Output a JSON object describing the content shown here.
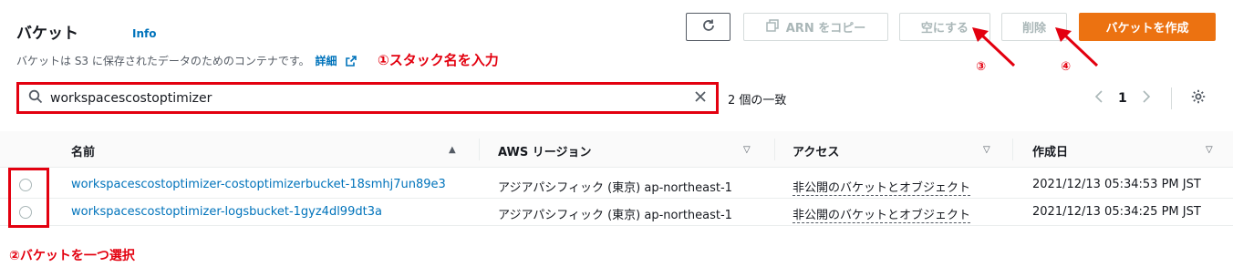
{
  "header": {
    "title": "バケット",
    "info": "Info",
    "description": "バケットは S3 に保存されたデータのためのコンテナです。",
    "detail_link": "詳細"
  },
  "toolbar": {
    "copy_arn": "ARN をコピー",
    "empty": "空にする",
    "delete": "削除",
    "create": "バケットを作成"
  },
  "annotations": {
    "step1": "①スタック名を入力",
    "step2": "②バケットを一つ選択",
    "step3": "③",
    "step4": "④",
    "color": "#e3000f"
  },
  "search": {
    "value": "workspacescostoptimizer",
    "match_count": "2 個の一致"
  },
  "pagination": {
    "page": "1"
  },
  "table": {
    "columns": [
      "名前",
      "AWS リージョン",
      "アクセス",
      "作成日"
    ],
    "rows": [
      {
        "name": "workspacescostoptimizer-costoptimizerbucket-18smhj7un89e3",
        "region": "アジアパシフィック (東京) ap-northeast-1",
        "access": "非公開のバケットとオブジェクト",
        "created": "2021/12/13 05:34:53 PM JST"
      },
      {
        "name": "workspacescostoptimizer-logsbucket-1gyz4dl99dt3a",
        "region": "アジアパシフィック (東京) ap-northeast-1",
        "access": "非公開のバケットとオブジェクト",
        "created": "2021/12/13 05:34:25 PM JST"
      }
    ]
  },
  "colors": {
    "primary": "#ec7211",
    "link": "#0073bb",
    "annotation": "#e3000f"
  },
  "icons": [
    "refresh-icon",
    "copy-icon",
    "external-link-icon",
    "search-icon",
    "clear-icon",
    "chevron-left-icon",
    "chevron-right-icon",
    "settings-icon",
    "sort-asc-icon",
    "sort-desc-icon",
    "arrow-icon"
  ]
}
